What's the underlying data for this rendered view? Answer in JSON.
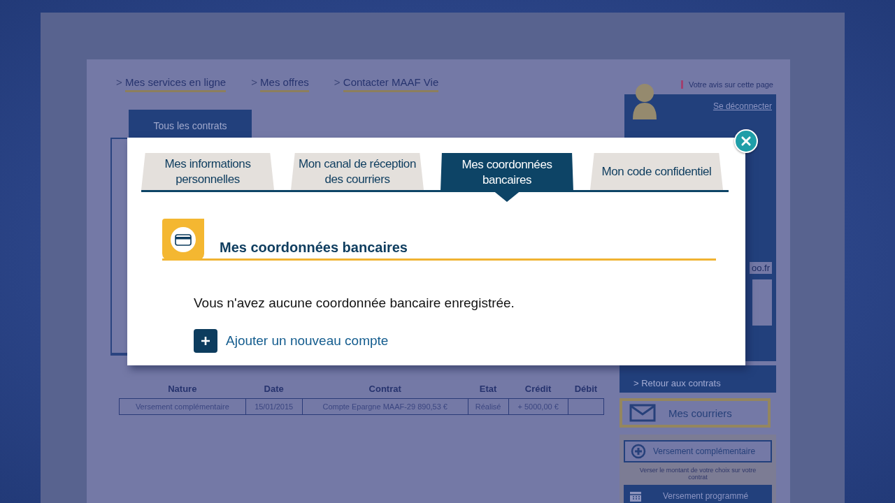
{
  "background_page": {
    "nav_links": [
      {
        "arrow": ">",
        "label": "Mes services en ligne"
      },
      {
        "arrow": ">",
        "label": "Mes offres"
      },
      {
        "arrow": ">",
        "label": "Contacter MAAF Vie"
      }
    ],
    "contracts_tab": "Tous les contrats",
    "feedback_link": "Votre avis sur cette page",
    "logout_link": "Se déconnecter",
    "email_fragment": "oo.fr",
    "back_link": "> Retour aux contrats",
    "mail_button": "Mes courriers",
    "actions": [
      {
        "kind": "outline",
        "label": "Versement complémentaire",
        "note": "Verser le montant de votre choix sur votre contrat"
      },
      {
        "kind": "filled",
        "label": "Versement programmé"
      }
    ],
    "table": {
      "columns": [
        "Nature",
        "Date",
        "Contrat",
        "Etat",
        "Crédit",
        "Débit"
      ],
      "rows": [
        [
          "Versement complémentaire",
          "15/01/2015",
          "Compte Epargne MAAF-29 890,53 €",
          "Réalisé",
          "+ 5000,00 €"
        ]
      ]
    }
  },
  "dialog": {
    "tabs": [
      {
        "label": "Mes informations personnelles",
        "selected": false
      },
      {
        "label": "Mon canal de réception des courriers",
        "selected": false
      },
      {
        "label": "Mes coordonnées bancaires",
        "selected": true
      },
      {
        "label": "Mon code confidentiel",
        "selected": false
      }
    ],
    "section_title": "Mes coordonnées bancaires",
    "message": "Vous n'avez aucune coordonnée bancaire enregistrée.",
    "add_link": "Ajouter un nouveau compte"
  }
}
